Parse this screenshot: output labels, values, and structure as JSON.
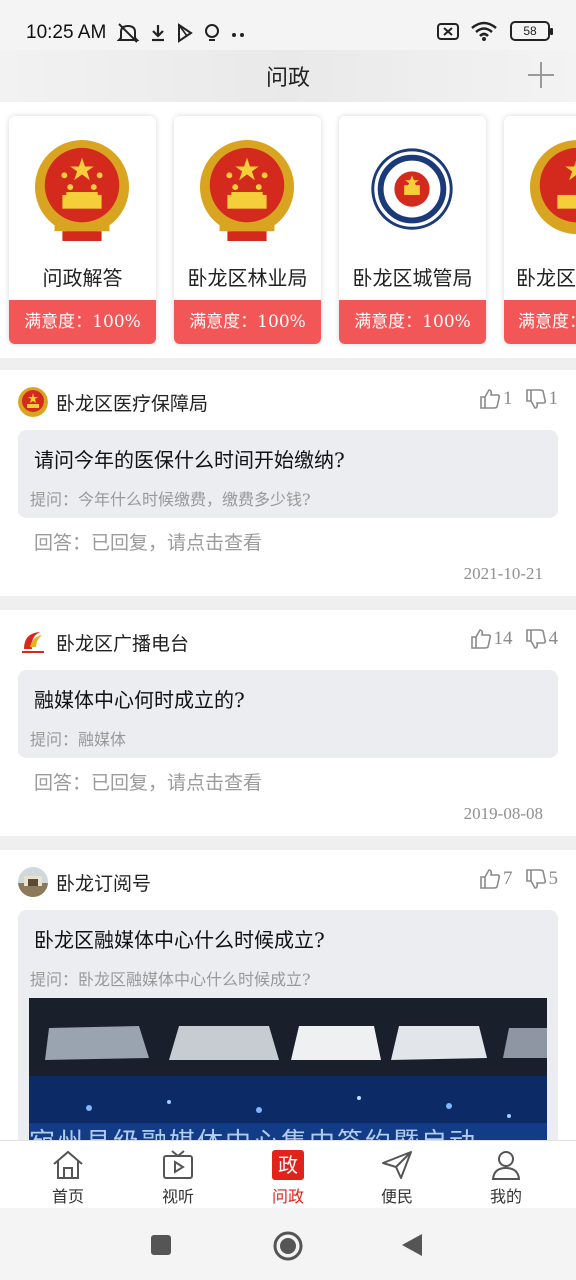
{
  "status_bar": {
    "time": "10:25 AM",
    "battery": "58",
    "left_icons": [
      "mute-icon",
      "download-icon",
      "play-store-icon",
      "lightbulb-icon",
      "more-dots-icon"
    ],
    "right_icons": [
      "no-sim-icon",
      "wifi-icon",
      "battery-icon"
    ]
  },
  "header": {
    "title": "问政",
    "add_icon": "plus-icon"
  },
  "departments": [
    {
      "name": "问政解答",
      "satisfaction": "满意度：100%",
      "emblem": "national-emblem"
    },
    {
      "name": "卧龙区林业局",
      "satisfaction": "满意度：100%",
      "emblem": "national-emblem"
    },
    {
      "name": "卧龙区城管局",
      "satisfaction": "满意度：100%",
      "emblem": "urban-management-badge"
    },
    {
      "name": "卧龙区",
      "satisfaction": "满意度：",
      "emblem": "national-emblem"
    }
  ],
  "posts": [
    {
      "org": "卧龙区医疗保障局",
      "likes": "1",
      "dislikes": "1",
      "question": "请问今年的医保什么时间开始缴纳?",
      "asked": "提问：今年什么时候缴费，缴费多少钱?",
      "answer": "回答：已回复，请点击查看",
      "date": "2021-10-21"
    },
    {
      "org": "卧龙区广播电台",
      "likes": "14",
      "dislikes": "4",
      "question": "融媒体中心何时成立的?",
      "asked": "提问：融媒体",
      "answer": "回答：已回复，请点击查看",
      "date": "2019-08-08"
    },
    {
      "org": "卧龙订阅号",
      "likes": "7",
      "dislikes": "5",
      "question": "卧龙区融媒体中心什么时候成立?",
      "asked": "提问：卧龙区融媒体中心什么时候成立?",
      "video_caption": "宛州县级融媒体中心集中签约暨启动"
    }
  ],
  "tabbar": [
    {
      "label": "首页",
      "icon": "home-icon"
    },
    {
      "label": "视听",
      "icon": "tv-play-icon"
    },
    {
      "label": "问政",
      "icon": "wenzheng-icon",
      "glyph": "政",
      "active": true
    },
    {
      "label": "便民",
      "icon": "paper-plane-icon"
    },
    {
      "label": "我的",
      "icon": "person-icon"
    }
  ],
  "colors": {
    "accent": "#e2231a",
    "satisfaction_bg": "#f25656"
  }
}
